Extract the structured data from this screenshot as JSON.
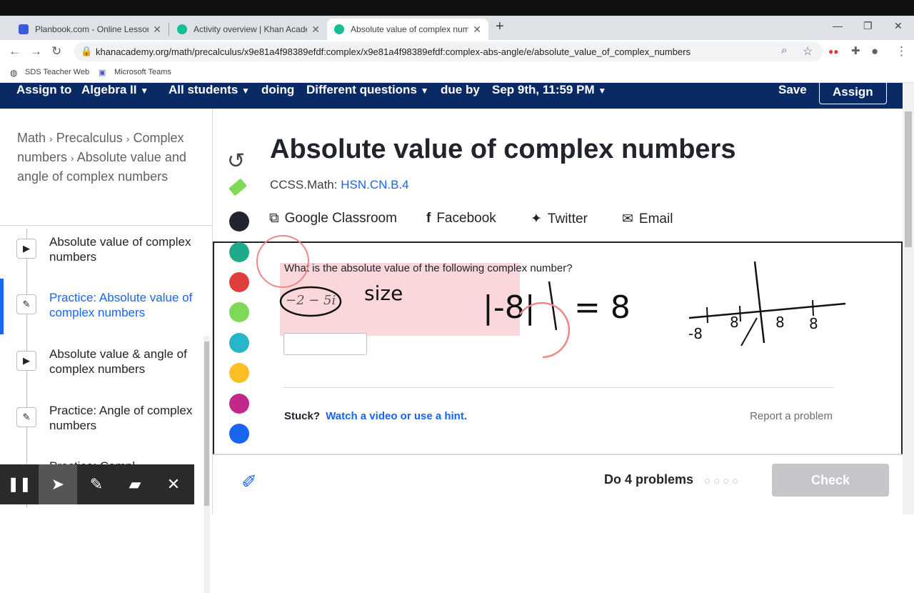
{
  "browser": {
    "tabs": [
      {
        "title": "Planbook.com - Online Lesson Pl",
        "favicon_color": "#3b5bdb"
      },
      {
        "title": "Activity overview | Khan Academy",
        "favicon_color": "#14bf96"
      },
      {
        "title": "Absolute value of complex numbe",
        "favicon_color": "#14bf96"
      }
    ],
    "url": "khanacademy.org/math/precalculus/x9e81a4f98389efdf:complex/x9e81a4f98389efdf:complex-abs-angle/e/absolute_value_of_complex_numbers",
    "bookmarks": [
      "SDS Teacher Web",
      "Microsoft Teams"
    ]
  },
  "assign_bar": {
    "assign_to": "Assign to",
    "course": "Algebra II",
    "students": "All students",
    "doing": "doing",
    "questions": "Different questions",
    "due_by": "due by",
    "due_date": "Sep 9th, 11:59 PM",
    "save": "Save",
    "assign": "Assign"
  },
  "sidebar": {
    "crumb1": "Math",
    "crumb2": "Precalculus",
    "crumb3": "Complex numbers",
    "crumb4": "Absolute value and angle of complex numbers",
    "items": [
      {
        "label": "Absolute value of complex numbers",
        "icon": "play-icon"
      },
      {
        "label": "Practice: Absolute value of complex numbers",
        "icon": "pencil-icon"
      },
      {
        "label": "Absolute value & angle of complex numbers",
        "icon": "play-icon"
      },
      {
        "label": "Practice: Angle of complex numbers",
        "icon": "pencil-icon"
      },
      {
        "label": "Practice: Compl",
        "icon": "pencil-icon"
      }
    ]
  },
  "exercise": {
    "title": "Absolute value of complex numbers",
    "ccss_label": "CCSS.Math:",
    "ccss_code": "HSN.CN.B.4",
    "share": {
      "google": "Google Classroom",
      "facebook": "Facebook",
      "twitter": "Twitter",
      "email": "Email"
    },
    "question": "What is the absolute value of the following complex number?",
    "expression": "−2 − 5i",
    "stuck": "Stuck?",
    "hint_link": "Watch a video or use a hint.",
    "report": "Report a problem",
    "do_problems": "Do 4 problems",
    "check": "Check"
  },
  "annotation_colors": [
    "#21242c",
    "#1fab89",
    "#e03d3d",
    "#7ed957",
    "#28b5c9",
    "#fbbf24",
    "#c2288b",
    "#1865f2"
  ],
  "handwriting": {
    "word": "size",
    "equation_left": "|-8|",
    "equation_right": "= 8",
    "numberline_labels": [
      "-8",
      "8",
      "8",
      "8"
    ]
  }
}
